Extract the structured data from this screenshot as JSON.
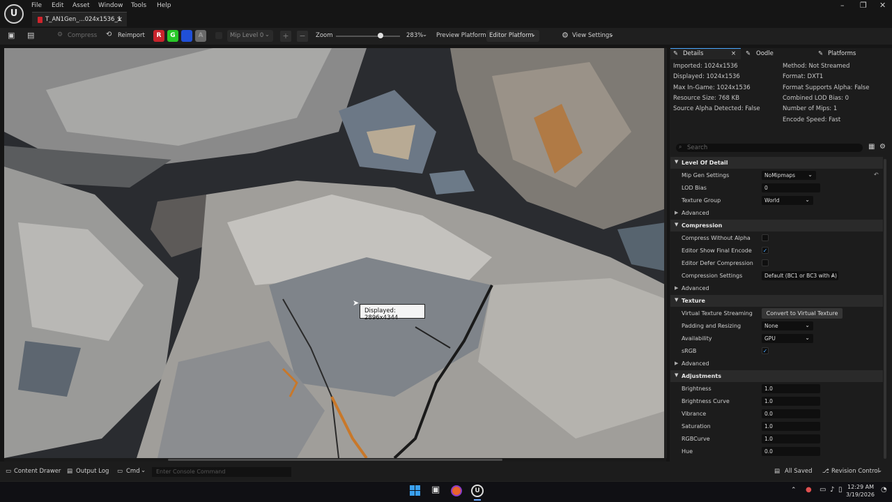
{
  "app": {
    "logo": "U"
  },
  "menu": [
    "File",
    "Edit",
    "Asset",
    "Window",
    "Tools",
    "Help"
  ],
  "tab": {
    "title": "T_AN1Gen_...024x1536_1"
  },
  "toolbar": {
    "compress": "Compress",
    "reimport": "Reimport",
    "channels": [
      "R",
      "G",
      "B",
      "A"
    ],
    "mip_level": "Mip Level 0",
    "zoom_label": "Zoom",
    "zoom_value": "283%",
    "zoom_fraction": 0.7,
    "preview_platform_label": "Preview Platform:",
    "preview_platform_value": "Editor Platform",
    "view_settings": "View Settings"
  },
  "viewport": {
    "tooltip": "Displayed: 2896x4344"
  },
  "panel": {
    "tabs": [
      "Details",
      "Oodle",
      "Platforms"
    ],
    "info_left": [
      "Imported: 1024x1536",
      "Displayed: 1024x1536",
      "Max In-Game: 1024x1536",
      "Resource Size: 768 KB",
      "Source Alpha Detected: False"
    ],
    "info_right": [
      "Method: Not Streamed",
      "Format: DXT1",
      "Format Supports Alpha: False",
      "Combined LOD Bias: 0",
      "Number of Mips: 1",
      "Encode Speed: Fast"
    ],
    "search_placeholder": "Search",
    "sections": {
      "lod": {
        "title": "Level Of Detail",
        "mip_gen_label": "Mip Gen Settings",
        "mip_gen_value": "NoMipmaps",
        "lod_bias_label": "LOD Bias",
        "lod_bias_value": "0",
        "texture_group_label": "Texture Group",
        "texture_group_value": "World",
        "advanced": "Advanced"
      },
      "compression": {
        "title": "Compression",
        "without_alpha": "Compress Without Alpha",
        "show_final": "Editor Show Final Encode",
        "defer": "Editor Defer Compression",
        "settings_label": "Compression Settings",
        "settings_value": "Default (BC1 or BC3 with A)",
        "advanced": "Advanced"
      },
      "texture": {
        "title": "Texture",
        "vts_label": "Virtual Texture Streaming",
        "vts_button": "Convert to Virtual Texture",
        "padding_label": "Padding and Resizing",
        "padding_value": "None",
        "availability_label": "Availability",
        "availability_value": "GPU",
        "srgb_label": "sRGB",
        "advanced": "Advanced"
      },
      "adjustments": {
        "title": "Adjustments",
        "brightness_label": "Brightness",
        "brightness_value": "1.0",
        "brightness_curve_label": "Brightness Curve",
        "brightness_curve_value": "1.0",
        "vibrance_label": "Vibrance",
        "vibrance_value": "0.0",
        "saturation_label": "Saturation",
        "saturation_value": "1.0",
        "rgbcurve_label": "RGBCurve",
        "rgbcurve_value": "1.0",
        "hue_label": "Hue",
        "hue_value": "0.0"
      }
    }
  },
  "status": {
    "content_drawer": "Content Drawer",
    "output_log": "Output Log",
    "cmd": "Cmd",
    "console_placeholder": "Enter Console Command",
    "all_saved": "All Saved",
    "revision_control": "Revision Control"
  },
  "taskbar": {
    "time": "12:29 AM",
    "date": "3/19/2026"
  },
  "colors": {
    "accent": "#4aa8ff",
    "tab_mark": "#d0242c",
    "channel_r": "#c8242c",
    "channel_g": "#28c828",
    "channel_b": "#2050d8",
    "channel_a": "#6a6a6a"
  }
}
